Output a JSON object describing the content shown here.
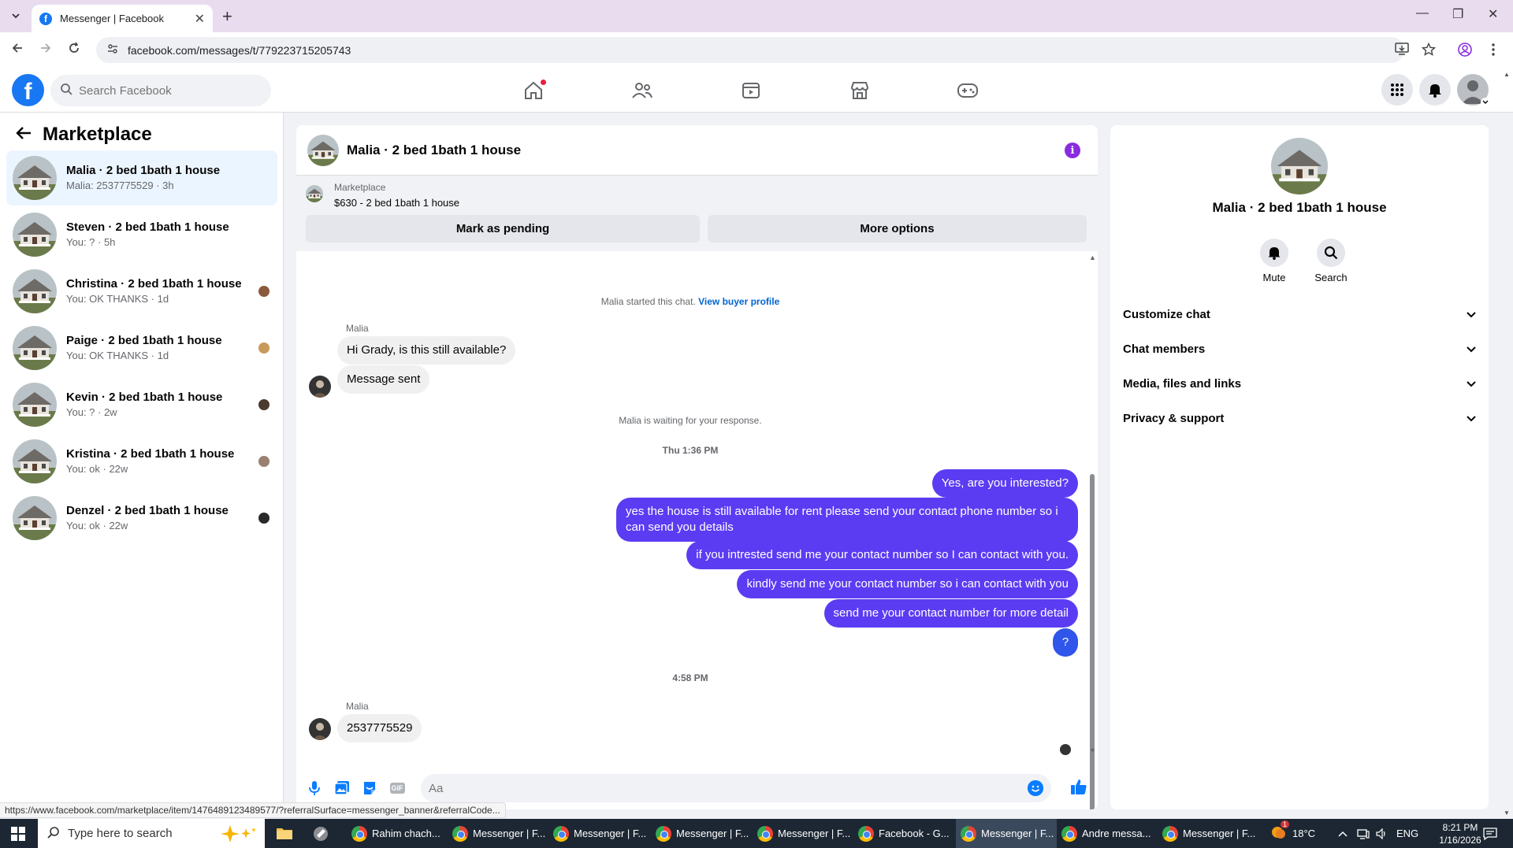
{
  "browser": {
    "tab_title": "Messenger | Facebook",
    "favicon_letter": "f",
    "url": "facebook.com/messages/t/779223715205743",
    "new_tab_symbol": "+",
    "tab_close_symbol": "✕",
    "minimize_symbol": "—",
    "restore_symbol": "❐",
    "close_symbol": "✕"
  },
  "header": {
    "logo_letter": "f",
    "search_placeholder": "Search Facebook"
  },
  "sidebar": {
    "title": "Marketplace",
    "conversations": [
      {
        "name": "Malia · 2 bed 1bath 1 house",
        "sub": "Malia: 2537775529 · 3h"
      },
      {
        "name": "Steven · 2 bed 1bath 1 house",
        "sub": "You: ? · 5h"
      },
      {
        "name": "Christina · 2 bed 1bath 1 house",
        "sub": "You: OK THANKS · 1d"
      },
      {
        "name": "Paige · 2 bed 1bath 1 house",
        "sub": "You: OK THANKS · 1d"
      },
      {
        "name": "Kevin · 2 bed 1bath 1 house",
        "sub": "You: ? · 2w"
      },
      {
        "name": "Kristina · 2 bed 1bath 1 house",
        "sub": "You: ok · 22w"
      },
      {
        "name": "Denzel · 2 bed 1bath 1 house",
        "sub": "You: ok · 22w"
      }
    ]
  },
  "chat": {
    "title": "Malia · 2 bed 1bath 1 house",
    "info_symbol": "i",
    "banner": {
      "label": "Marketplace",
      "price_line": "$630 - 2 bed 1bath 1 house",
      "pending_button": "Mark as pending",
      "more_button": "More options"
    },
    "started_text": "Malia started this chat.",
    "buyer_profile_link": "View buyer profile",
    "sender_name_1": "Malia",
    "incoming_1": "Hi Grady, is this still available?",
    "incoming_2": "Message sent",
    "waiting_text": "Malia is waiting for your response.",
    "timestamp_1": "Thu 1:36 PM",
    "outgoing": [
      "Yes, are you interested?",
      "yes the house is still available for rent please send your contact phone number so i can send you details",
      "if you intrested send me your contact number so I can contact with you.",
      "kindly send me your contact number so i can contact with you",
      "send me your contact number for more detail",
      "?"
    ],
    "timestamp_2": "4:58 PM",
    "sender_name_2": "Malia",
    "incoming_3": "2537775529",
    "composer_placeholder": "Aa",
    "gif_label": "GIF"
  },
  "right_panel": {
    "name": "Malia · 2 bed 1bath 1 house",
    "mute_label": "Mute",
    "search_label": "Search",
    "sections": [
      "Customize chat",
      "Chat members",
      "Media, files and links",
      "Privacy & support"
    ]
  },
  "status_bar_url": "https://www.facebook.com/marketplace/item/1476489123489577/?referralSurface=messenger_banner&referralCode...",
  "taskbar": {
    "search_placeholder": "Type here to search",
    "apps": [
      "Rahim chach...",
      "Messenger | F...",
      "Messenger | F...",
      "Messenger | F...",
      "Messenger | F...",
      "Facebook - G...",
      "Messenger | F...",
      "Andre messa...",
      "Messenger | F..."
    ],
    "weather": "18°C",
    "language": "ENG",
    "time": "8:21 PM",
    "date": "1/16/2026",
    "notification_count": "1"
  },
  "colors": {
    "fb_blue": "#1877f2",
    "outgoing_bubble": "#5b3cf2",
    "active_conversation": "#ebf5ff"
  }
}
